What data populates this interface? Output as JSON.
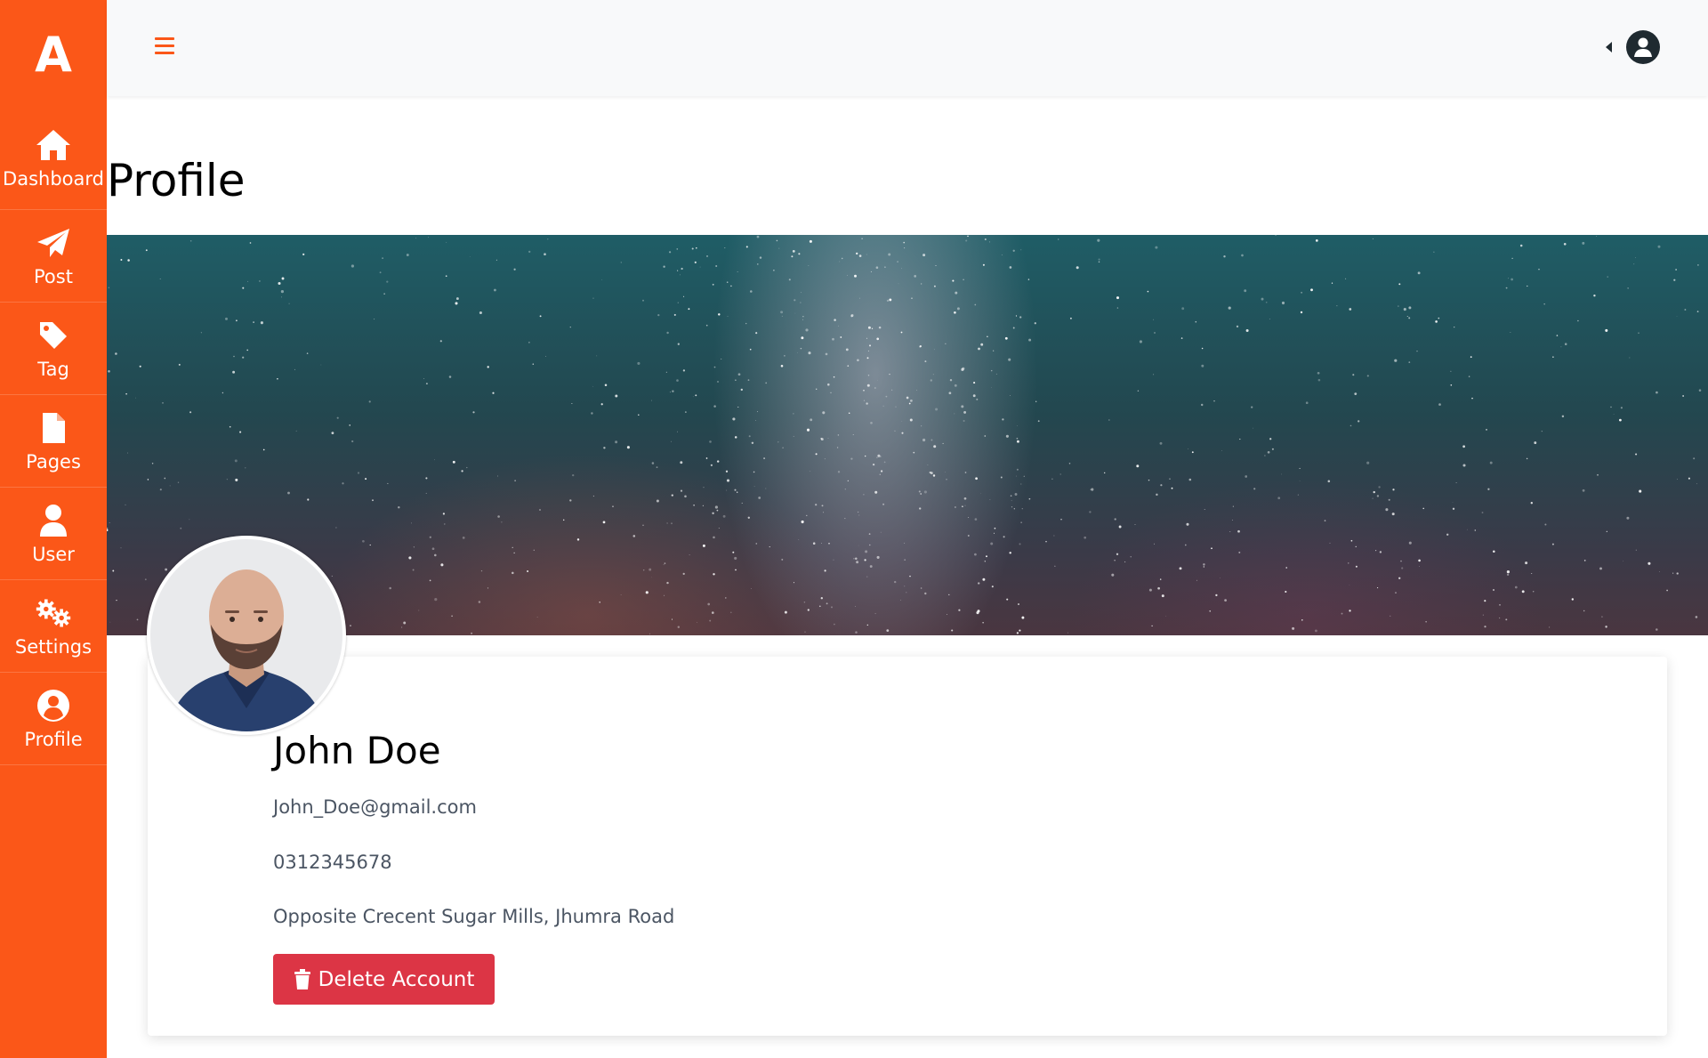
{
  "theme": {
    "accent": "#fb5718",
    "danger": "#dc3545"
  },
  "brand": {
    "logo_letter": "A",
    "icon": "brand-logo"
  },
  "sidebar": {
    "items": [
      {
        "label": "Dashboard",
        "icon": "home-icon"
      },
      {
        "label": "Post",
        "icon": "paper-plane-icon"
      },
      {
        "label": "Tag",
        "icon": "tag-icon"
      },
      {
        "label": "Pages",
        "icon": "file-icon"
      },
      {
        "label": "User",
        "icon": "user-icon"
      },
      {
        "label": "Settings",
        "icon": "gears-icon"
      },
      {
        "label": "Profile",
        "icon": "user-circle-icon"
      }
    ]
  },
  "topbar": {
    "menu_icon": "hamburger-icon",
    "user_icon": "user-circle-icon",
    "caret_icon": "caret-left-icon"
  },
  "page": {
    "title": "Profile"
  },
  "profile": {
    "name": "John Doe",
    "email": "John_Doe@gmail.com",
    "phone": "0312345678",
    "address": "Opposite Crecent Sugar Mills, Jhumra Road",
    "delete_label": "Delete Account",
    "delete_icon": "trash-icon"
  }
}
